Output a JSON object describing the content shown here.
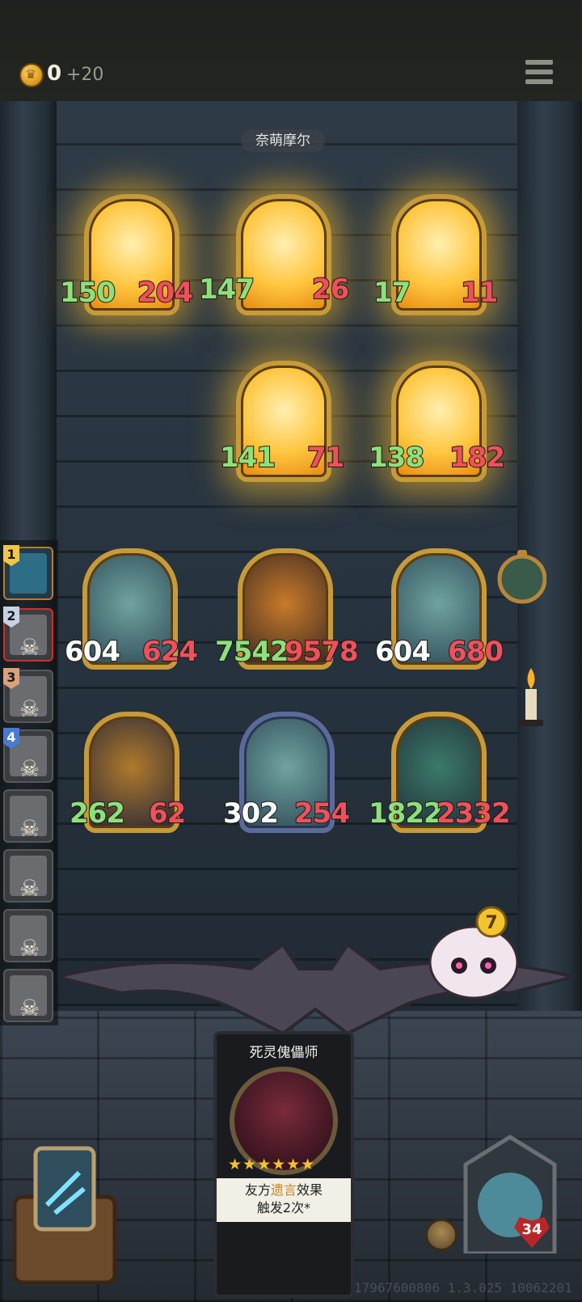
{
  "hud": {
    "gold": "0",
    "gold_income": "+20"
  },
  "enemy": {
    "name": "奈萌摩尔",
    "minions": [
      {
        "atk": "150",
        "hp": "204"
      },
      {
        "atk": "147",
        "hp": "26"
      },
      {
        "atk": "17",
        "hp": "11"
      },
      {
        "atk": "141",
        "hp": "71"
      },
      {
        "atk": "138",
        "hp": "182"
      }
    ]
  },
  "player": {
    "minions": [
      {
        "atk": "604",
        "hp": "624"
      },
      {
        "atk": "7542",
        "hp": "9578"
      },
      {
        "atk": "604",
        "hp": "680"
      },
      {
        "atk": "262",
        "hp": "62"
      },
      {
        "atk": "302",
        "hp": "254"
      },
      {
        "atk": "1822",
        "hp": "2332"
      }
    ],
    "health": "34"
  },
  "sidebar": {
    "ranks": [
      "1",
      "2",
      "3",
      "4"
    ]
  },
  "featured_card": {
    "name": "死灵傀儡师",
    "stars": "★★★★★★",
    "desc_pre": "友方",
    "desc_hl": "遗言",
    "desc_post": "效果",
    "desc_line2": "触发2次*"
  },
  "mascot_badge": "7",
  "build_id": "17967600806 1.3.025 10062201",
  "colors": {
    "atk": "#8ee07a",
    "hp": "#f0505a",
    "gold": "#f4c430",
    "glow": "#ffc640"
  }
}
